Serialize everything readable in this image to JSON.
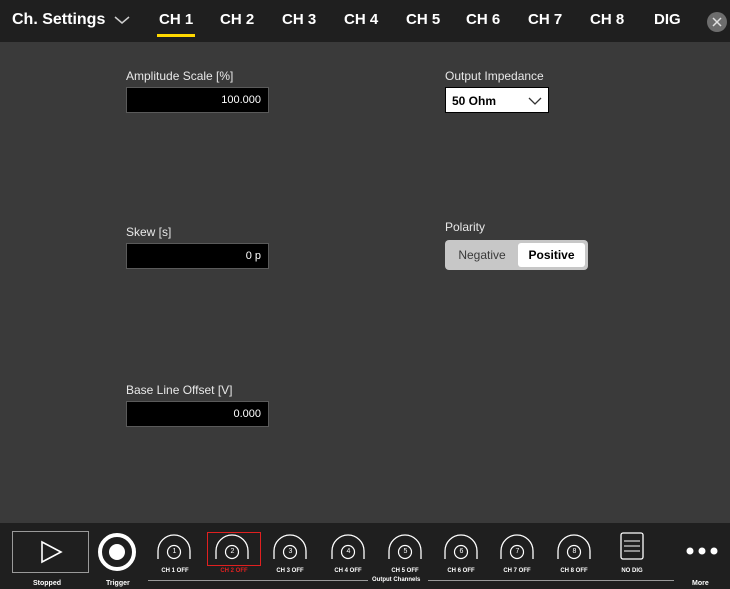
{
  "header": {
    "title": "Ch. Settings",
    "dropdown_icon": "chevron-down-icon",
    "tabs": [
      {
        "label": "CH 1",
        "active": true
      },
      {
        "label": "CH 2",
        "active": false
      },
      {
        "label": "CH 3",
        "active": false
      },
      {
        "label": "CH 4",
        "active": false
      },
      {
        "label": "CH 5",
        "active": false
      },
      {
        "label": "CH 6",
        "active": false
      },
      {
        "label": "CH 7",
        "active": false
      },
      {
        "label": "CH 8",
        "active": false
      },
      {
        "label": "DIG",
        "active": false
      }
    ],
    "close_icon": "close-icon"
  },
  "settings": {
    "amplitude_scale": {
      "label": "Amplitude Scale [%]",
      "value": "100.000"
    },
    "output_impedance": {
      "label": "Output Impedance",
      "value": "50 Ohm"
    },
    "skew": {
      "label": "Skew [s]",
      "value": "0 p"
    },
    "polarity": {
      "label": "Polarity",
      "options": [
        "Negative",
        "Positive"
      ],
      "selected": "Positive"
    },
    "base_line_offset": {
      "label": "Base Line Offset [V]",
      "value": "0.000"
    }
  },
  "footer": {
    "run": {
      "label": "Stopped",
      "icon": "play-icon"
    },
    "trigger": {
      "label": "Trigger",
      "icon": "trigger-icon"
    },
    "channels": [
      {
        "num": "1",
        "label": "CH 1 OFF"
      },
      {
        "num": "2",
        "label": "CH 2 OFF"
      },
      {
        "num": "3",
        "label": "CH 3 OFF"
      },
      {
        "num": "4",
        "label": "CH 4 OFF"
      },
      {
        "num": "5",
        "label": "CH 5 OFF"
      },
      {
        "num": "6",
        "label": "CH 6 OFF"
      },
      {
        "num": "7",
        "label": "CH 7 OFF"
      },
      {
        "num": "8",
        "label": "CH 8 OFF"
      }
    ],
    "selected_channel": "2",
    "dig": {
      "label": "NO DIG",
      "icon": "digital-icon"
    },
    "group_label": "Output Channels",
    "more": {
      "label": "More",
      "icon": "more-icon"
    }
  },
  "colors": {
    "background": "#3a3a3a",
    "bar": "#1f1f1f",
    "accent": "#ffd800",
    "selected_outline": "#e02020"
  }
}
